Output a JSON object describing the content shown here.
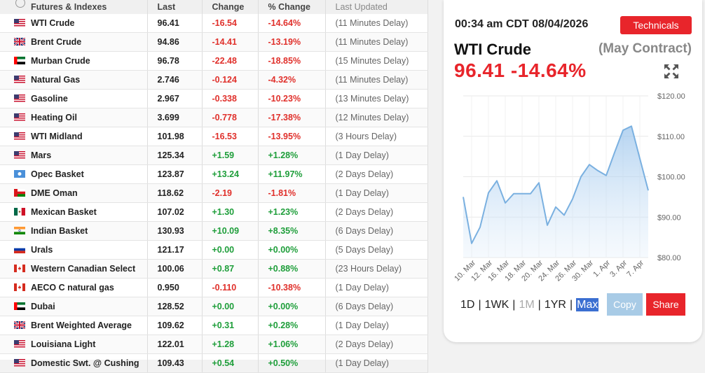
{
  "table": {
    "headers": {
      "name": "Futures & Indexes",
      "last": "Last",
      "change": "Change",
      "pct": "% Change",
      "updated": "Last Updated"
    },
    "rows": [
      {
        "flag": "us",
        "name": "WTI Crude",
        "last": "96.41",
        "change": "-16.54",
        "pct": "-14.64%",
        "updated": "(11 Minutes Delay)"
      },
      {
        "flag": "uk",
        "name": "Brent Crude",
        "last": "94.86",
        "change": "-14.41",
        "pct": "-13.19%",
        "updated": "(11 Minutes Delay)"
      },
      {
        "flag": "ae",
        "name": "Murban Crude",
        "last": "96.78",
        "change": "-22.48",
        "pct": "-18.85%",
        "updated": "(15 Minutes Delay)"
      },
      {
        "flag": "us",
        "name": "Natural Gas",
        "last": "2.746",
        "change": "-0.124",
        "pct": "-4.32%",
        "updated": "(11 Minutes Delay)"
      },
      {
        "flag": "us",
        "name": "Gasoline",
        "last": "2.967",
        "change": "-0.338",
        "pct": "-10.23%",
        "updated": "(13 Minutes Delay)"
      },
      {
        "flag": "us",
        "name": "Heating Oil",
        "last": "3.699",
        "change": "-0.778",
        "pct": "-17.38%",
        "updated": "(12 Minutes Delay)"
      },
      {
        "flag": "us",
        "name": "WTI Midland",
        "last": "101.98",
        "change": "-16.53",
        "pct": "-13.95%",
        "updated": "(3 Hours Delay)"
      },
      {
        "flag": "us",
        "name": "Mars",
        "last": "125.34",
        "change": "+1.59",
        "pct": "+1.28%",
        "updated": "(1 Day Delay)"
      },
      {
        "flag": "opec",
        "name": "Opec Basket",
        "last": "123.87",
        "change": "+13.24",
        "pct": "+11.97%",
        "updated": "(2 Days Delay)"
      },
      {
        "flag": "om",
        "name": "DME Oman",
        "last": "118.62",
        "change": "-2.19",
        "pct": "-1.81%",
        "updated": "(1 Day Delay)"
      },
      {
        "flag": "mx",
        "name": "Mexican Basket",
        "last": "107.02",
        "change": "+1.30",
        "pct": "+1.23%",
        "updated": "(2 Days Delay)"
      },
      {
        "flag": "in",
        "name": "Indian Basket",
        "last": "130.93",
        "change": "+10.09",
        "pct": "+8.35%",
        "updated": "(6 Days Delay)"
      },
      {
        "flag": "ru",
        "name": "Urals",
        "last": "121.17",
        "change": "+0.00",
        "pct": "+0.00%",
        "updated": "(5 Days Delay)"
      },
      {
        "flag": "ca",
        "name": "Western Canadian Select",
        "last": "100.06",
        "change": "+0.87",
        "pct": "+0.88%",
        "updated": "(23 Hours Delay)"
      },
      {
        "flag": "ca",
        "name": "AECO C natural gas",
        "last": "0.950",
        "change": "-0.110",
        "pct": "-10.38%",
        "updated": "(1 Day Delay)"
      },
      {
        "flag": "ae",
        "name": "Dubai",
        "last": "128.52",
        "change": "+0.00",
        "pct": "+0.00%",
        "updated": "(6 Days Delay)"
      },
      {
        "flag": "uk",
        "name": "Brent Weighted Average",
        "last": "109.62",
        "change": "+0.31",
        "pct": "+0.28%",
        "updated": "(1 Day Delay)"
      },
      {
        "flag": "us",
        "name": "Louisiana Light",
        "last": "122.01",
        "change": "+1.28",
        "pct": "+1.06%",
        "updated": "(2 Days Delay)"
      },
      {
        "flag": "us",
        "name": "Domestic Swt. @ Cushing",
        "last": "109.43",
        "change": "+0.54",
        "pct": "+0.50%",
        "updated": "(1 Day Delay)"
      }
    ]
  },
  "card": {
    "timestamp": "00:34 am CDT 08/04/2026",
    "technicals_label": "Technicals",
    "title": "WTI Crude",
    "contract": "(May Contract)",
    "price_line": "96.41 -14.64%",
    "ranges": [
      "1D",
      "1WK",
      "1M",
      "1YR",
      "Max"
    ],
    "copy_label": "Copy",
    "share_label": "Share"
  },
  "colors": {
    "accent_red": "#e8252b",
    "negative": "#e0302b",
    "positive": "#1e9e3a",
    "line": "#7ab0e0"
  },
  "chart_data": {
    "type": "area",
    "x_tick_labels": [
      "10. Mar",
      "12. Mar",
      "16. Mar",
      "18. Mar",
      "20. Mar",
      "24. Mar",
      "26. Mar",
      "30. Mar",
      "1. Apr",
      "3. Apr",
      "7. Apr"
    ],
    "y_tick_labels": [
      "$120.00",
      "$110.00",
      "$100.00",
      "$90.00",
      "$80.00"
    ],
    "ylim": [
      80,
      120
    ],
    "values": [
      95,
      83.5,
      87.5,
      96,
      99,
      93.5,
      95.8,
      95.8,
      95.8,
      98.5,
      88,
      92.5,
      90.5,
      94.5,
      100,
      103,
      101.5,
      100.3,
      106,
      111.5,
      112.5,
      104.5,
      96.6
    ]
  }
}
